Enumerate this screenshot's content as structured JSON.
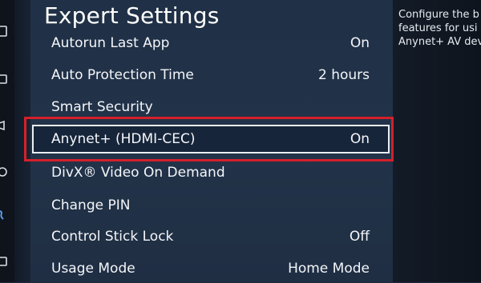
{
  "header": {
    "title": "Expert Settings"
  },
  "menu": {
    "items": [
      {
        "label": "Autorun Last App",
        "value": "On"
      },
      {
        "label": "Auto Protection Time",
        "value": "2 hours"
      },
      {
        "label": "Smart Security",
        "value": ""
      },
      {
        "label": "Anynet+ (HDMI-CEC)",
        "value": "On"
      },
      {
        "label": "DivX® Video On Demand",
        "value": ""
      },
      {
        "label": "Change PIN",
        "value": ""
      },
      {
        "label": "Control Stick Lock",
        "value": "Off"
      },
      {
        "label": "Usage Mode",
        "value": "Home Mode"
      }
    ],
    "focused_index": 3
  },
  "description": {
    "lines": [
      "Configure the b",
      "features for usi",
      "Anynet+ AV dev"
    ]
  },
  "rail": {
    "icons": [
      "menu-rail-icon",
      "picture-rail-icon",
      "sound-rail-icon",
      "support-rail-icon",
      "settings-rail-icon",
      "device-rail-icon"
    ]
  },
  "colors": {
    "highlight_frame": "#d4202a",
    "focus_border": "#e9eef4",
    "panel_bg": "#223349"
  }
}
